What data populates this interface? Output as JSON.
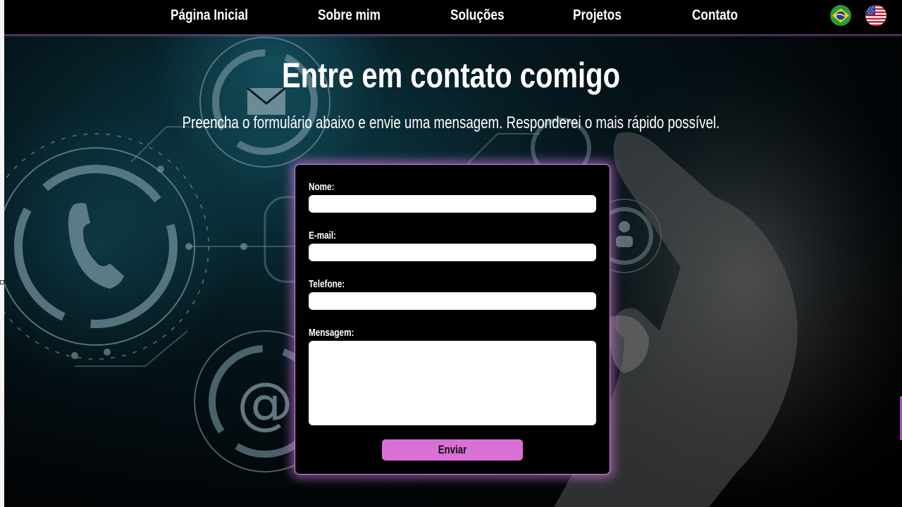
{
  "nav": {
    "items": [
      {
        "label": "Página Inicial"
      },
      {
        "label": "Sobre mim"
      },
      {
        "label": "Soluções"
      },
      {
        "label": "Projetos"
      },
      {
        "label": "Contato"
      }
    ],
    "flags": [
      {
        "icon": "brazil-flag-icon"
      },
      {
        "icon": "usa-flag-icon"
      }
    ]
  },
  "header": {
    "title": "Entre em contato comigo",
    "subtitle": "Preencha o formulário abaixo e envie uma mensagem. Responderei o mais rápido possível."
  },
  "form": {
    "name_label": "Nome:",
    "name_value": "",
    "email_label": "E-mail:",
    "email_value": "",
    "phone_label": "Telefone:",
    "phone_value": "",
    "message_label": "Mensagem:",
    "message_value": "",
    "submit_label": "Enviar"
  },
  "colors": {
    "accent": "#da70d6",
    "card_glow": "#d678e6",
    "background": "#000000",
    "text": "#ffffff"
  }
}
